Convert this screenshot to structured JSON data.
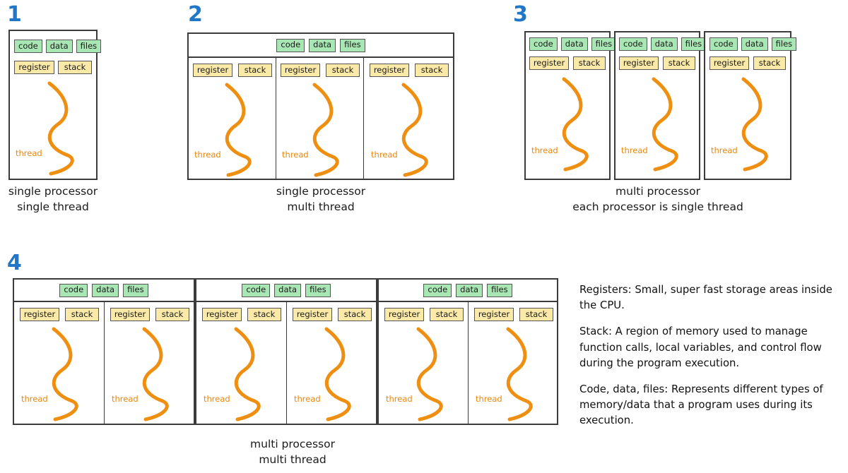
{
  "labels": {
    "code": "code",
    "data": "data",
    "files": "files",
    "register": "register",
    "stack": "stack",
    "thread": "thread"
  },
  "colors": {
    "number_blue": "#2176c7",
    "memory_green": "#a8e6b4",
    "register_yellow": "#fbe9a8",
    "thread_orange": "#ef8f12",
    "box_border": "#3b3b3b",
    "chip_border": "#555555"
  },
  "panels": [
    {
      "number": "1",
      "caption": "single processor\nsingle thread",
      "processors": 1,
      "threads_per_processor": 1,
      "memory_scope": "per-processor"
    },
    {
      "number": "2",
      "caption": "single processor\nmulti thread",
      "processors": 1,
      "threads_per_processor": 3,
      "memory_scope": "shared-top-bar"
    },
    {
      "number": "3",
      "caption": "multi processor\neach processor is single thread",
      "processors": 3,
      "threads_per_processor": 1,
      "memory_scope": "per-processor"
    },
    {
      "number": "4",
      "caption": "multi processor\nmulti thread",
      "processors": 3,
      "threads_per_processor": 2,
      "memory_scope": "shared-top-bar"
    }
  ],
  "notes": [
    "Registers: Small, super fast storage areas inside the CPU.",
    "Stack: A region of memory used to manage function calls, local variables, and control flow during the program execution.",
    "Code, data, files: Represents different types of memory/data that a program uses during its execution."
  ]
}
